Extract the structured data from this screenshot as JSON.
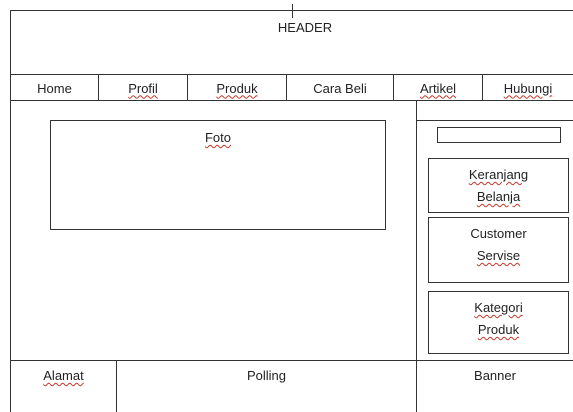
{
  "header": {
    "label": "HEADER"
  },
  "nav": {
    "items": [
      {
        "label": "Home"
      },
      {
        "label": "Profil"
      },
      {
        "label": "Produk"
      },
      {
        "label": "Cara Beli"
      },
      {
        "label": "Artikel"
      },
      {
        "label": "Hubungi"
      }
    ]
  },
  "main": {
    "photo_label": "Foto"
  },
  "sidebar": {
    "cart_line1": "Keranjang",
    "cart_line2": "Belanja",
    "cs_line1": "Customer",
    "cs_line2": "Servise",
    "cat_line1": "Kategori",
    "cat_line2": "Produk"
  },
  "footer": {
    "address_label": "Alamat",
    "polling_label": "Polling",
    "banner_label": "Banner"
  }
}
